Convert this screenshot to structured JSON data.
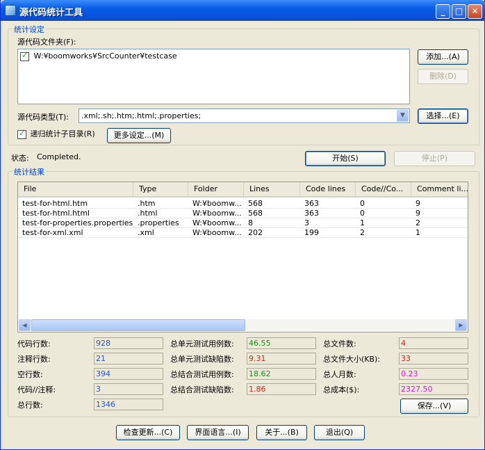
{
  "window": {
    "title": "源代码统计工具"
  },
  "settings": {
    "group_label": "统计设定",
    "source_folder_label": "源代码文件夹(F):",
    "folders": [
      {
        "checked": true,
        "path": "W:¥boomworks¥SrcCounter¥testcase"
      }
    ],
    "add_button": "添加...(A)",
    "delete_button": "删除(D)",
    "type_label": "源代码类型(T):",
    "type_value": ".xml;.sh;.htm;.html;.properties;",
    "select_button": "选择...(E)",
    "recursive_label": "递归统计子目录(R)",
    "more_settings_button": "更多设定...(M)"
  },
  "status": {
    "label": "状态:",
    "value": "Completed.",
    "start_button": "开始(S)",
    "stop_button": "停止(P)"
  },
  "results": {
    "group_label": "统计结果",
    "columns": [
      "File",
      "Type",
      "Folder",
      "Lines",
      "Code lines",
      "Code//Co...",
      "Comment li..."
    ],
    "rows": [
      [
        "test-for-html.htm",
        ".htm",
        "W:¥boomw...",
        "568",
        "363",
        "0",
        "9"
      ],
      [
        "test-for-html.html",
        ".html",
        "W:¥boomw...",
        "568",
        "363",
        "0",
        "9"
      ],
      [
        "test-for-properties.properties",
        ".properties",
        "W:¥boomw...",
        "8",
        "3",
        "1",
        "2"
      ],
      [
        "test-for-xml.xml",
        ".xml",
        "W:¥boomw...",
        "202",
        "199",
        "2",
        "1"
      ]
    ]
  },
  "stats": {
    "code_lines_label": "代码行数:",
    "code_lines": "928",
    "comment_lines_label": "注释行数:",
    "comment_lines": "21",
    "blank_lines_label": "空行数:",
    "blank_lines": "394",
    "code_comment_label": "代码//注释:",
    "code_comment": "3",
    "total_lines_label": "总行数:",
    "total_lines": "1346",
    "unit_cases_label": "总单元测试用例数:",
    "unit_cases": "46.55",
    "unit_defects_label": "总单元测试缺陷数:",
    "unit_defects": "9.31",
    "integ_cases_label": "总结合测试用例数:",
    "integ_cases": "18.62",
    "integ_defects_label": "总结合测试缺陷数:",
    "integ_defects": "1.86",
    "total_files_label": "总文件数:",
    "total_files": "4",
    "total_size_label": "总文件大小(KB):",
    "total_size": "33",
    "man_month_label": "总人月数:",
    "man_month": "0.23",
    "total_cost_label": "总成本($):",
    "total_cost": "2327.50",
    "save_button": "保存...(V)"
  },
  "footer": {
    "check_update": "检查更新...(C)",
    "language": "界面语言...(I)",
    "about": "关于...(B)",
    "exit": "退出(Q)"
  },
  "colors": {
    "blue_value": "#2a50c8",
    "green_value": "#1e8a1e",
    "red_value": "#d21e1e",
    "magenta_value": "#c81ec8",
    "group_label": "#0046d5"
  }
}
